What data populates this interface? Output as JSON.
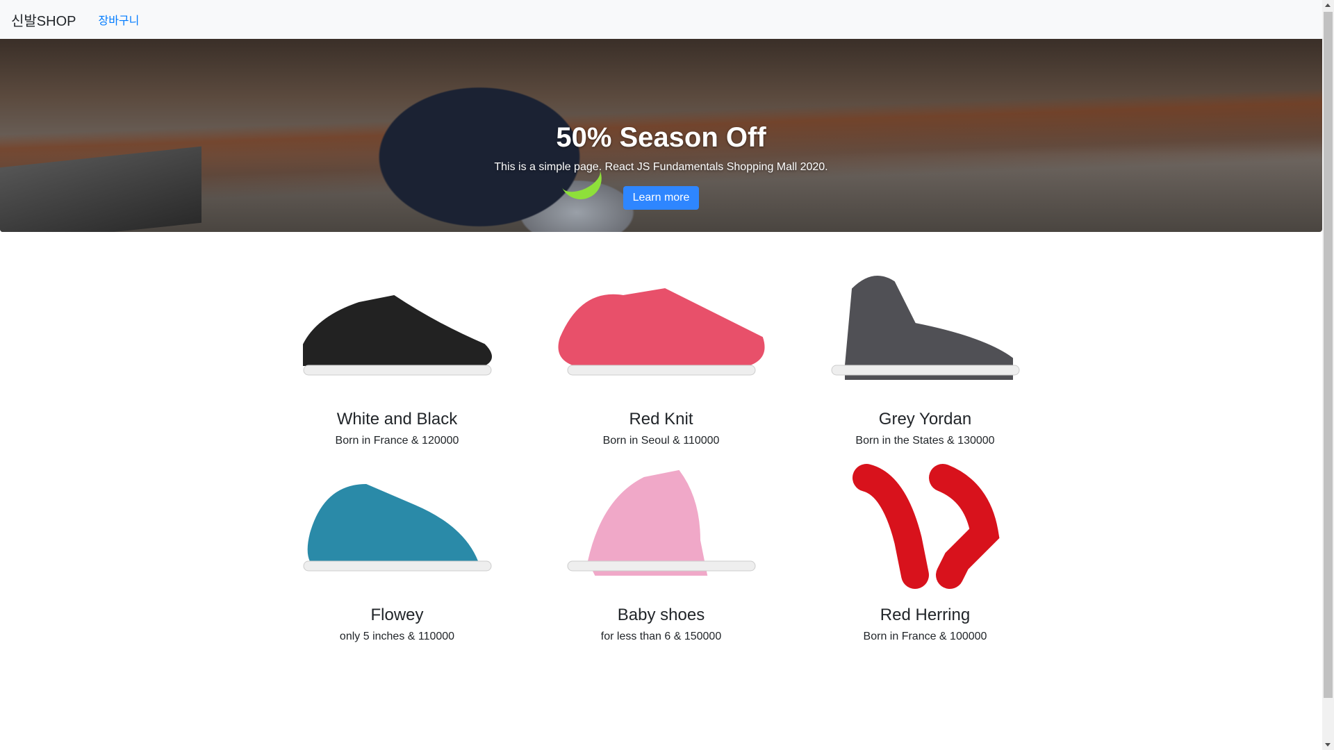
{
  "nav": {
    "brand": "신발SHOP",
    "cart_link": "장바구니"
  },
  "hero": {
    "title": "50% Season Off",
    "subtitle": "This is a simple page. React JS Fundamentals Shopping Mall 2020.",
    "button": "Learn more",
    "button_color": "#2e86ff"
  },
  "products": [
    {
      "title": "White and Black",
      "desc": "Born in France & 120000",
      "color": "#222222"
    },
    {
      "title": "Red Knit",
      "desc": "Born in Seoul & 110000",
      "color": "#e8506a"
    },
    {
      "title": "Grey Yordan",
      "desc": "Born in the States & 130000",
      "color": "#505055"
    },
    {
      "title": "Flowey",
      "desc": "only 5 inches & 110000",
      "color": "#2a8aa8"
    },
    {
      "title": "Baby shoes",
      "desc": "for less than 6 & 150000",
      "color": "#f0a8c8"
    },
    {
      "title": "Red Herring",
      "desc": "Born in France & 100000",
      "color": "#d8121c"
    }
  ]
}
